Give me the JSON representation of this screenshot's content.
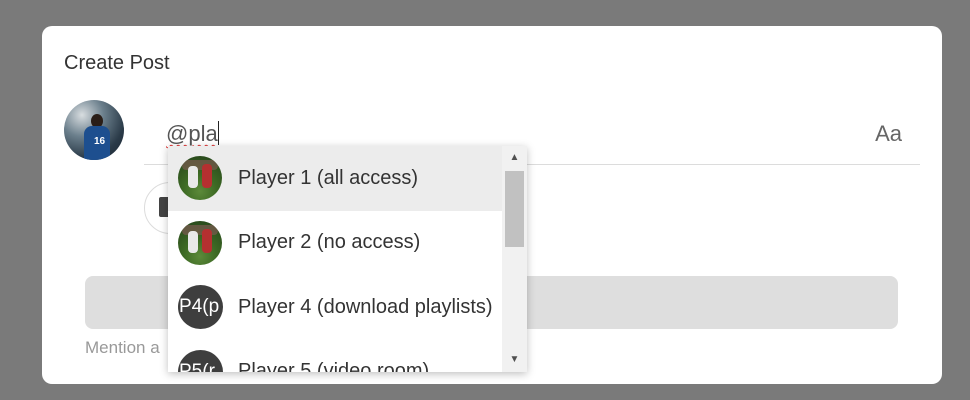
{
  "modal": {
    "title": "Create Post"
  },
  "composer": {
    "typed_text": "@pla",
    "format_button": "Aa",
    "hint": "Mention a"
  },
  "mention_dropdown": {
    "items": [
      {
        "label": "Player 1 (all access)",
        "avatar_type": "photo",
        "selected": true
      },
      {
        "label": "Player 2 (no access)",
        "avatar_type": "photo",
        "selected": false
      },
      {
        "label": "Player 4 (download playlists)",
        "avatar_type": "initials",
        "initials": "P4(p",
        "selected": false
      },
      {
        "label": "Player 5 (video room)",
        "avatar_type": "initials",
        "initials": "P5(r",
        "selected": false
      }
    ]
  },
  "icons": {
    "image": "image-icon",
    "scroll_up": "chevron-up-icon",
    "scroll_down": "chevron-down-icon"
  },
  "colors": {
    "overlay": "#7a7a7a",
    "selected_row": "#ececec",
    "initials_avatar": "#3e3e3e"
  }
}
